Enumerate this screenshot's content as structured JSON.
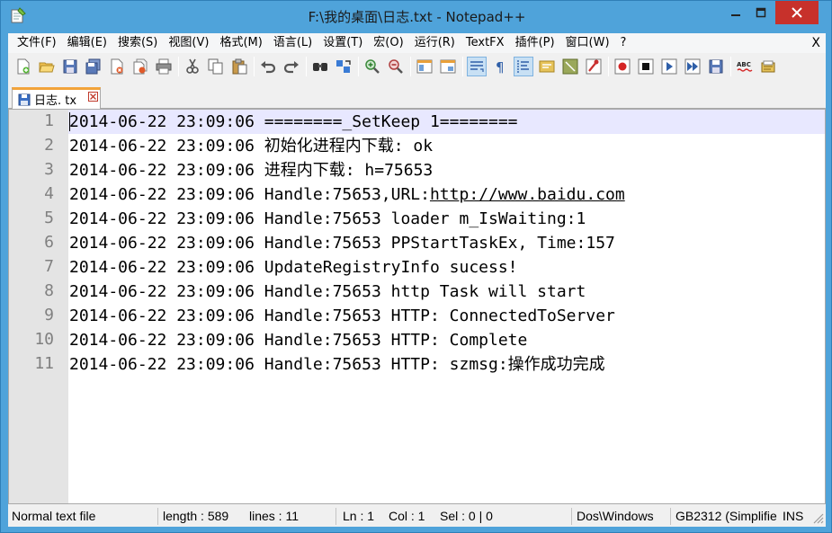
{
  "window": {
    "title": "F:\\我的桌面\\日志.txt - Notepad++"
  },
  "menu": {
    "items": [
      "文件(F)",
      "编辑(E)",
      "搜索(S)",
      "视图(V)",
      "格式(M)",
      "语言(L)",
      "设置(T)",
      "宏(O)",
      "运行(R)",
      "TextFX",
      "插件(P)",
      "窗口(W)",
      "?"
    ],
    "close_label": "X"
  },
  "toolbar": {
    "icons": [
      "new-file-icon",
      "open-file-icon",
      "save-icon",
      "save-all-icon",
      "close-icon",
      "close-all-icon",
      "print-icon",
      "cut-icon",
      "copy-icon",
      "paste-icon",
      "undo-icon",
      "redo-icon",
      "find-icon",
      "replace-icon",
      "zoom-in-icon",
      "zoom-out-icon",
      "sync-vertical-icon",
      "sync-horizontal-icon",
      "word-wrap-icon",
      "show-all-chars-icon",
      "indent-guide-icon",
      "doc-map-icon",
      "function-list-icon",
      "folder-workspace-icon",
      "record-macro-icon",
      "stop-macro-icon",
      "play-macro-icon",
      "run-macro-multiple-icon",
      "save-macro-icon",
      "spell-check-icon",
      "clipboard-history-icon"
    ]
  },
  "tab": {
    "label": "日志. tx"
  },
  "editor": {
    "line_numbers": [
      "1",
      "2",
      "3",
      "4",
      "5",
      "6",
      "7",
      "8",
      "9",
      "10",
      "11"
    ],
    "lines": [
      {
        "text": "2014-06-22 23:09:06 ========_SetKeep 1========"
      },
      {
        "text": "2014-06-22 23:09:06 初始化进程内下载: ok"
      },
      {
        "text": "2014-06-22 23:09:06 进程内下载: h=75653"
      },
      {
        "prefix": "2014-06-22 23:09:06 Handle:75653,URL:",
        "link": "http://www.baidu.com"
      },
      {
        "text": "2014-06-22 23:09:06 Handle:75653 loader m_IsWaiting:1"
      },
      {
        "text": "2014-06-22 23:09:06 Handle:75653 PPStartTaskEx, Time:157"
      },
      {
        "text": "2014-06-22 23:09:06 UpdateRegistryInfo sucess!"
      },
      {
        "text": "2014-06-22 23:09:06 Handle:75653 http Task will start"
      },
      {
        "text": "2014-06-22 23:09:06 Handle:75653 HTTP: ConnectedToServer"
      },
      {
        "text": "2014-06-22 23:09:06 Handle:75653 HTTP: Complete"
      },
      {
        "text": "2014-06-22 23:09:06 Handle:75653 HTTP: szmsg:操作成功完成"
      }
    ]
  },
  "status": {
    "file_type": "Normal text file",
    "length": "length : 589",
    "lines": "lines : 11",
    "ln": "Ln : 1",
    "col": "Col : 1",
    "sel": "Sel : 0 | 0",
    "eol": "Dos\\Windows",
    "encoding": "GB2312 (Simplifie",
    "mode": "INS"
  },
  "colors": {
    "window_frame": "#4fa3da",
    "close_button": "#c7312b",
    "current_line": "#e8e8ff",
    "tab_accent": "#f2a33a",
    "gutter": "#e4e4e4"
  }
}
